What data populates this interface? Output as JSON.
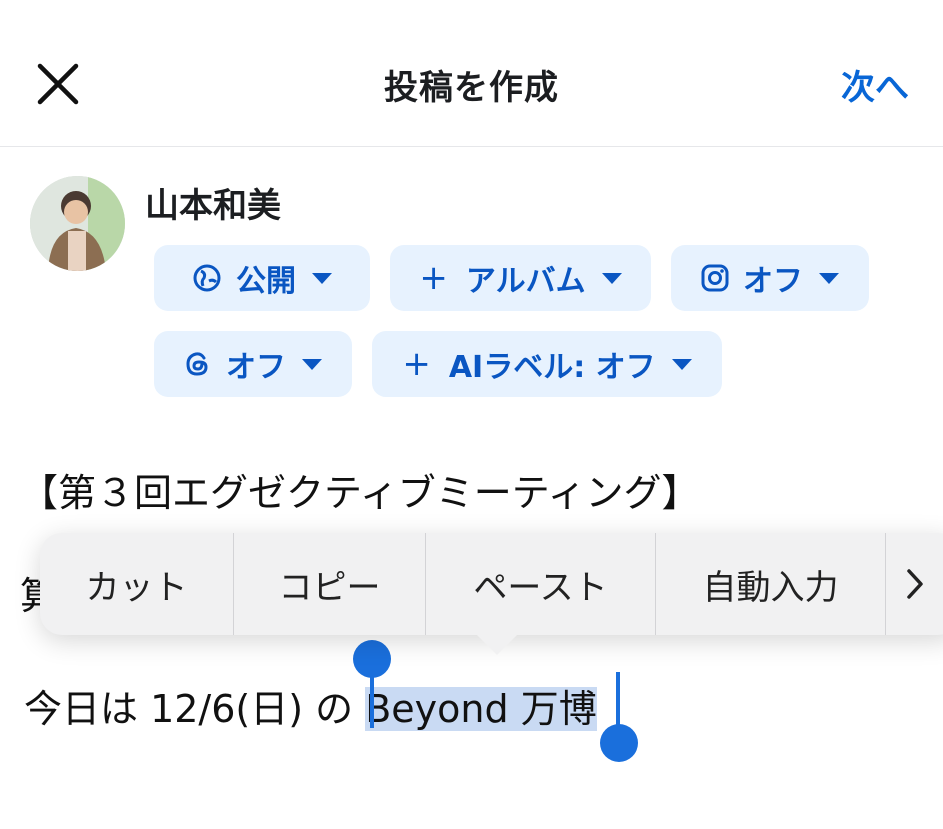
{
  "header": {
    "title": "投稿を作成",
    "next_label": "次へ"
  },
  "user": {
    "name": "山本和美"
  },
  "chips": {
    "privacy": "公開",
    "album": "アルバム",
    "instagram": "オフ",
    "threads": "オフ",
    "ai_label": "AIラベル: オフ"
  },
  "post": {
    "line1": "【第３回エグゼクティブミーティング】",
    "line2_visible": "算",
    "line3_before": "今日は 12/6(日) の ",
    "line3_selected": "Beyond 万博"
  },
  "edit_menu": {
    "items": [
      "カット",
      "コピー",
      "ペースト",
      "自動入力"
    ]
  },
  "colors": {
    "accent": "#0866d6",
    "chip_bg": "#e7f2fe",
    "selection": "#c9daf3"
  }
}
